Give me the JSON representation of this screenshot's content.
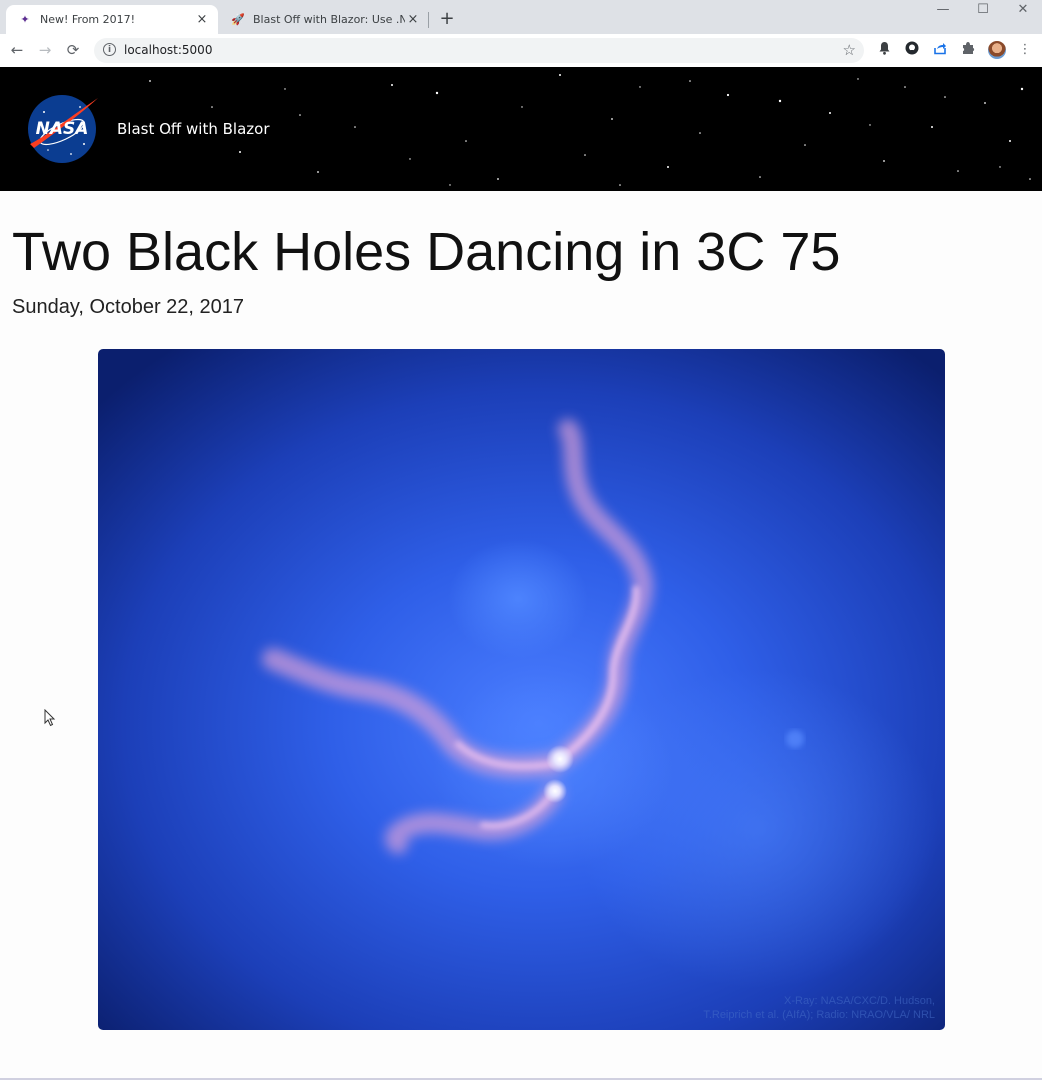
{
  "browser": {
    "tabs": [
      {
        "title": "New! From 2017!",
        "favicon": "blazor-favicon",
        "close": "×"
      },
      {
        "title": "Blast Off with Blazor: Use .NET 5 t",
        "favicon": "rocket-favicon",
        "close": "×"
      }
    ],
    "new_tab": "+",
    "window": {
      "minimize": "—",
      "maximize": "☐",
      "close": "✕"
    },
    "nav": {
      "back": "←",
      "forward": "→",
      "reload": "⟳"
    },
    "address": {
      "info": "i",
      "url": "localhost:5000",
      "star": "☆"
    },
    "toolbar_icons": {
      "bell": "🔔",
      "github": "●",
      "share": "⇪",
      "extensions": "✱",
      "menu": "⋮"
    }
  },
  "site": {
    "title": "Blast Off with Blazor",
    "logo_text": "NASA"
  },
  "article": {
    "title": "Two Black Holes Dancing in 3C 75",
    "date": "Sunday, October 22, 2017",
    "image_credit_line1": "X-Ray: NASA/CXC/D. Hudson,",
    "image_credit_line2": "T.Reiprich et al. (AIfA); Radio: NRAO/VLA/ NRL"
  },
  "colors": {
    "header_bg": "#000000",
    "nasa_blue": "#0b3d91",
    "nasa_red": "#fc3d21",
    "photo_blue": "#2f5fe8"
  }
}
